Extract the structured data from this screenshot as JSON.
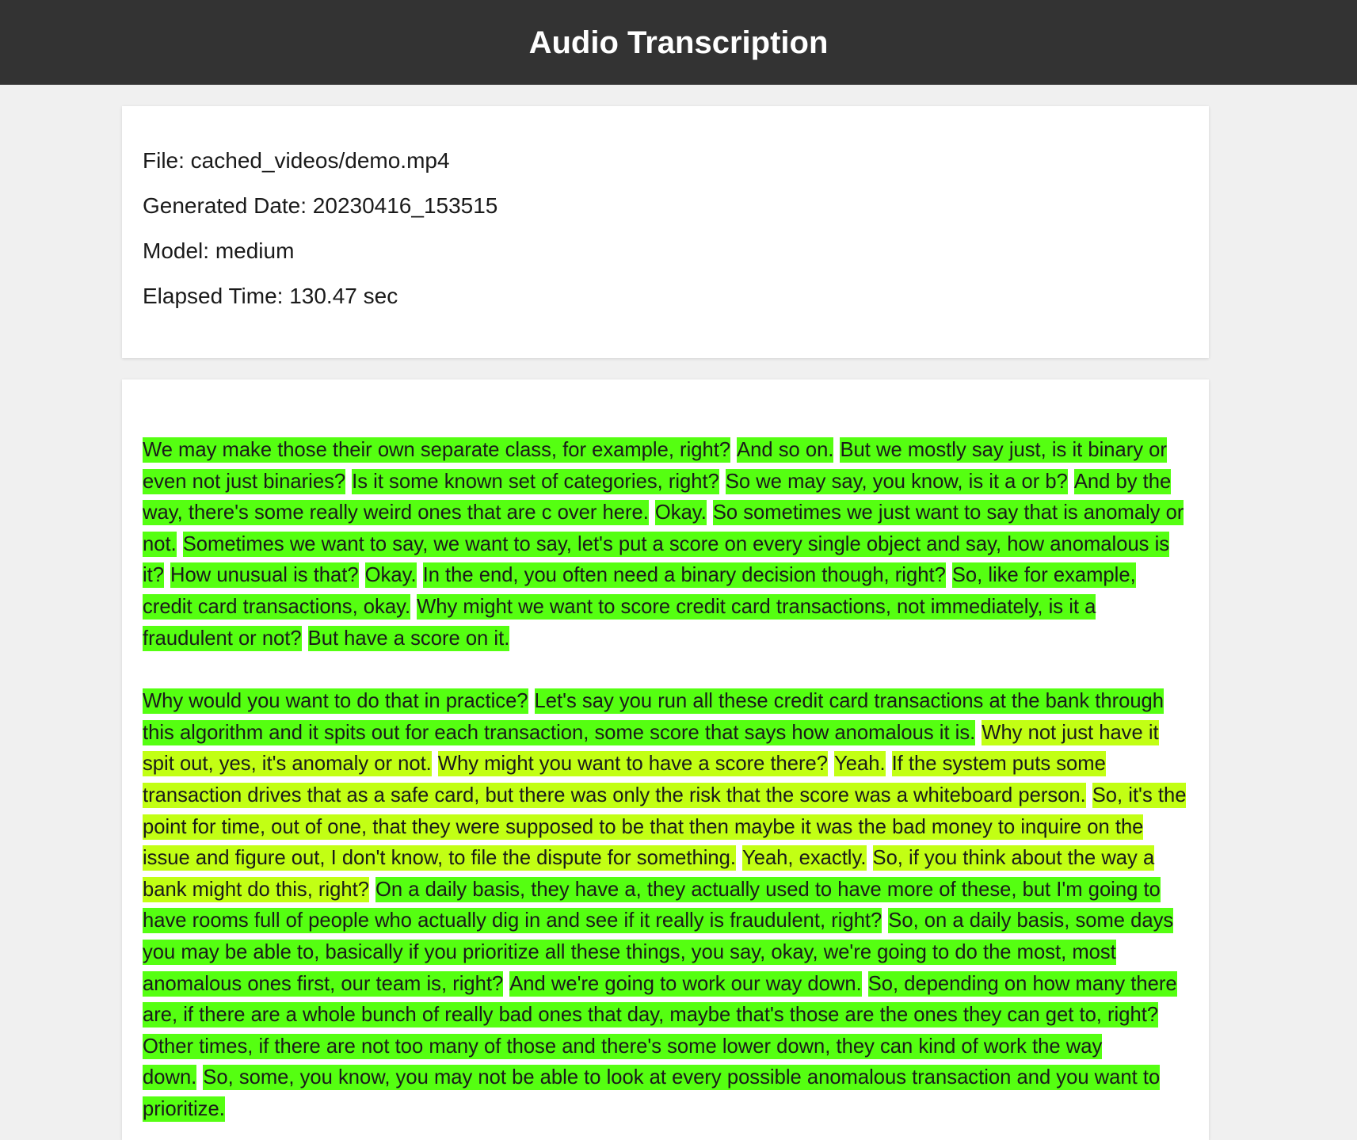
{
  "header": {
    "title": "Audio Transcription"
  },
  "meta": {
    "file": "File: cached_videos/demo.mp4",
    "date": "Generated Date: 20230416_153515",
    "model": "Model: medium",
    "elapsed": "Elapsed Time: 130.47 sec"
  },
  "colors": {
    "high_confidence": "#55ff11",
    "mid_confidence": "#c2ff14",
    "header_bg": "#333333"
  },
  "paragraphs": [
    {
      "segments": [
        {
          "text": "We may make those their own separate class, for example, right?",
          "level": "high"
        },
        {
          "text": "And so on.",
          "level": "high"
        },
        {
          "text": "But we mostly say just, is it binary or even not just binaries?",
          "level": "high"
        },
        {
          "text": "Is it some known set of categories, right?",
          "level": "high"
        },
        {
          "text": "So we may say, you know, is it a or b?",
          "level": "high"
        },
        {
          "text": "And by the way, there's some really weird ones that are c over here.",
          "level": "high"
        },
        {
          "text": "Okay.",
          "level": "high"
        },
        {
          "text": "So sometimes we just want to say that is anomaly or not.",
          "level": "high"
        },
        {
          "text": "Sometimes we want to say, we want to say, let's put a score on every single object and say, how anomalous is it?",
          "level": "high"
        },
        {
          "text": "How unusual is that?",
          "level": "high"
        },
        {
          "text": "Okay.",
          "level": "high"
        },
        {
          "text": "In the end, you often need a binary decision though, right?",
          "level": "high"
        },
        {
          "text": "So, like for example, credit card transactions, okay.",
          "level": "high"
        },
        {
          "text": "Why might we want to score credit card transactions, not immediately, is it a fraudulent or not?",
          "level": "high"
        },
        {
          "text": "But have a score on it.",
          "level": "high"
        }
      ]
    },
    {
      "segments": [
        {
          "text": " Why would you want to do that in practice?",
          "level": "high"
        },
        {
          "text": "Let's say you run all these credit card transactions at the bank through this algorithm and it spits out for each transaction, some score that says how anomalous it is.",
          "level": "high"
        },
        {
          "text": "Why not just have it spit out, yes, it's anomaly or not.",
          "level": "mid"
        },
        {
          "text": "Why might you want to have a score there?",
          "level": "mid"
        },
        {
          "text": "Yeah.",
          "level": "mid"
        },
        {
          "text": "If the system puts some transaction drives that as a safe card, but there was only the risk that the score was a whiteboard person.",
          "level": "mid"
        },
        {
          "text": "So, it's the point for time, out of one, that they were supposed to be that then maybe it was the bad money to inquire on the issue and figure out, I don't know, to file the dispute for something.",
          "level": "mid"
        },
        {
          "text": "Yeah, exactly.",
          "level": "mid"
        },
        {
          "text": "So, if you think about the way a bank might do this, right?",
          "level": "mid"
        },
        {
          "text": "On a daily basis, they have a, they actually used to have more of these, but I'm going to have rooms full of people who actually dig in and see if it really is fraudulent, right?",
          "level": "high"
        },
        {
          "text": "So, on a daily basis, some days you may be able to, basically if you prioritize all these things, you say, okay, we're going to do the most, most anomalous ones first, our team is, right?",
          "level": "high"
        },
        {
          "text": "And we're going to work our way down.",
          "level": "high"
        },
        {
          "text": "So, depending on how many there are, if there are a whole bunch of really bad ones that day, maybe that's those are the ones they can get to, right?",
          "level": "high"
        },
        {
          "text": "Other times, if there are not too many of those and there's some lower down, they can kind of work the way down.",
          "level": "high"
        },
        {
          "text": "So, some, you know, you may not be able to look at every possible anomalous transaction and you want to prioritize.",
          "level": "high"
        }
      ]
    }
  ]
}
